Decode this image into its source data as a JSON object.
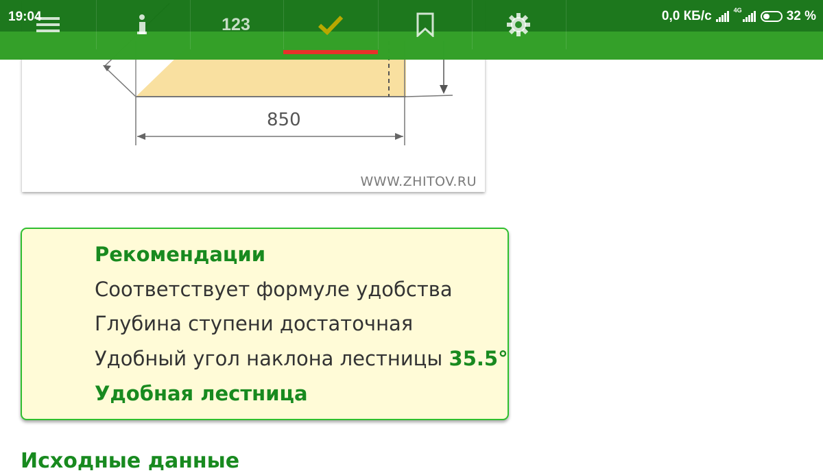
{
  "status_bar": {
    "time": "19:04",
    "net_speed": "0,0 КБ/с",
    "network_type": "4G",
    "battery_percent": "32 %"
  },
  "toolbar": {
    "tabs": [
      {
        "icon": "menu-icon"
      },
      {
        "icon": "info-icon"
      },
      {
        "label": "123"
      },
      {
        "icon": "check-icon",
        "active": true
      },
      {
        "icon": "bookmark-icon"
      },
      {
        "icon": "gear-icon"
      }
    ],
    "colors": {
      "bar": "#1c8c1c",
      "indicator": "#e8312a",
      "check": "#b8a800"
    }
  },
  "diagram": {
    "dimension_label": "850",
    "watermark": "WWW.ZHITOV.RU",
    "fill_color": "#f9e0a0"
  },
  "recommendations": {
    "title": "Рекомендации",
    "items": [
      "Соответствует формуле удобства",
      "Глубина ступени достаточная"
    ],
    "angle_text": "Удобный угол наклона лестницы",
    "angle_value": "35.5°",
    "verdict": "Удобная лестница",
    "accent": "#188a1f",
    "background": "#fffbd7"
  },
  "next_section": {
    "heading": "Исходные данные"
  }
}
